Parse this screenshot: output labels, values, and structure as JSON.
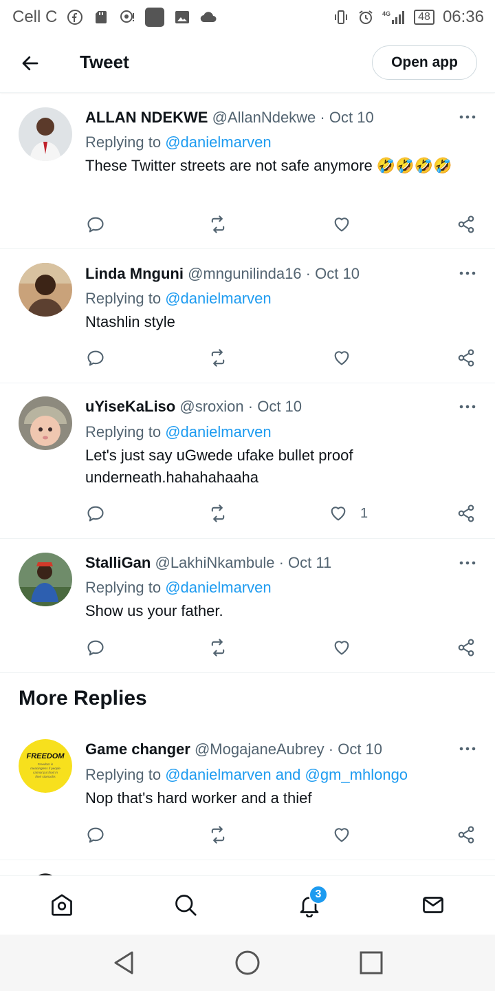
{
  "status_bar": {
    "carrier": "Cell C",
    "time": "06:36",
    "battery": "48",
    "network": "4G"
  },
  "header": {
    "title": "Tweet",
    "open_app": "Open app"
  },
  "tweets": [
    {
      "name": "ALLAN NDEKWE",
      "handle": "@AllanNdekwe",
      "date": "Oct 10",
      "replying_prefix": "Replying to ",
      "mentions": "@danielmarven",
      "text": "These Twitter streets are not safe anymore 🤣🤣🤣🤣",
      "likes": ""
    },
    {
      "name": "Linda Mnguni",
      "handle": "@mngunilinda16",
      "date": "Oct 10",
      "replying_prefix": "Replying to ",
      "mentions": "@danielmarven",
      "text": "Ntashlin style",
      "likes": ""
    },
    {
      "name": "uYiseKaLiso",
      "handle": "@sroxion",
      "date": "Oct 10",
      "replying_prefix": "Replying to ",
      "mentions": "@danielmarven",
      "text": "Let's just say uGwede ufake bullet proof underneath.hahahahaaha",
      "likes": "1"
    },
    {
      "name": "StalliGan",
      "handle": "@LakhiNkambule",
      "date": "Oct 11",
      "replying_prefix": "Replying to ",
      "mentions": "@danielmarven",
      "text": "Show us your father.",
      "likes": ""
    }
  ],
  "more_replies": {
    "title": "More Replies",
    "tweet": {
      "name": "Game changer",
      "handle": "@MogajaneAubrey",
      "date": "Oct 10",
      "replying_prefix": "Replying to ",
      "mentions": "@danielmarven and @gm_mhlongo",
      "text": "Nop that's hard worker and a thief",
      "avatar_text": "FREEDOM",
      "avatar_subtext": "Freedom is meaningless if people cannot put food in their stomachs"
    }
  },
  "bottom_nav": {
    "notifications_badge": "3"
  },
  "colors": {
    "accent": "#1d9bf0",
    "text_primary": "#0f1419",
    "text_secondary": "#536471"
  }
}
